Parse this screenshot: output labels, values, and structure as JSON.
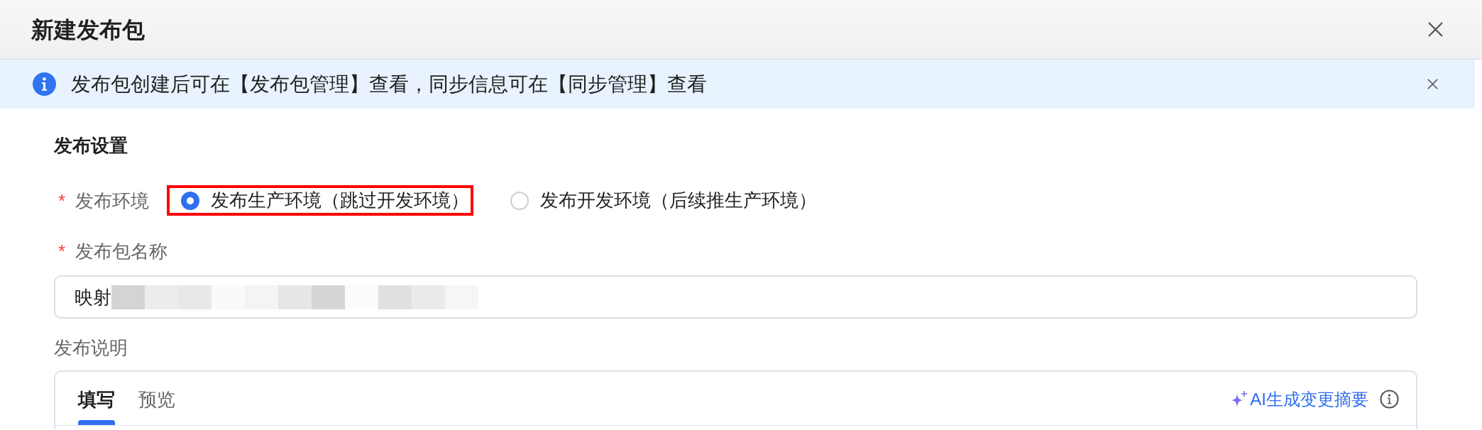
{
  "dialog": {
    "title": "新建发布包"
  },
  "notice": {
    "text": "发布包创建后可在【发布包管理】查看，同步信息可在【同步管理】查看"
  },
  "section": {
    "title": "发布设置"
  },
  "environment": {
    "label": "发布环境",
    "required_mark": "*",
    "options": [
      {
        "label": "发布生产环境（跳过开发环境）",
        "selected": true,
        "highlighted": true
      },
      {
        "label": "发布开发环境（后续推生产环境）",
        "selected": false,
        "highlighted": false
      }
    ]
  },
  "package_name": {
    "label": "发布包名称",
    "required_mark": "*",
    "value": "映射",
    "redacted": true
  },
  "description": {
    "label": "发布说明",
    "tabs": [
      {
        "label": "填写",
        "selected": true
      },
      {
        "label": "预览",
        "selected": false
      }
    ],
    "ai_button": {
      "label": "AI生成变更摘要"
    }
  }
}
